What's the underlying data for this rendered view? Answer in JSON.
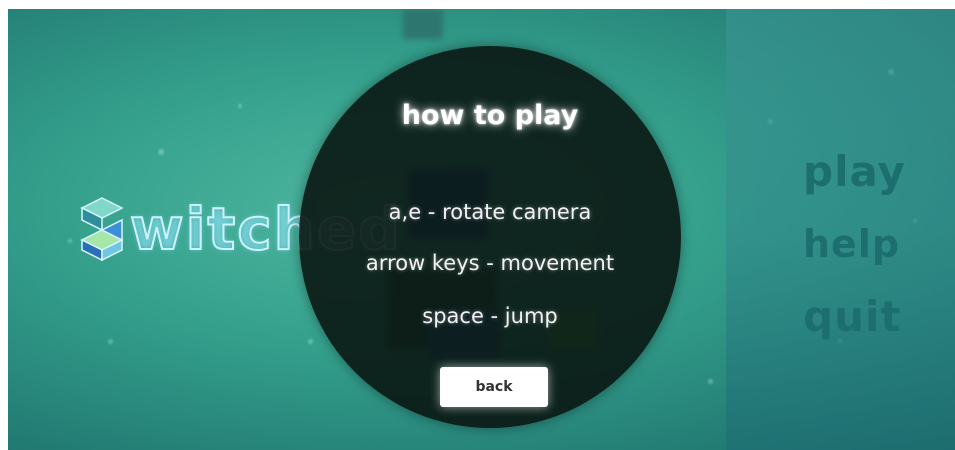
{
  "logo": {
    "text": "witched",
    "icon": "s-cube-logo-icon"
  },
  "help_panel": {
    "title": "how to play",
    "lines": [
      "a,e - rotate camera",
      "arrow keys - movement",
      "space - jump"
    ],
    "back_label": "back"
  },
  "menu": {
    "play_label": "play",
    "help_label": "help",
    "quit_label": "quit"
  },
  "colors": {
    "background": "#35a18d",
    "menu_text": "#1d6f6f",
    "overlay": "#0a1612",
    "logo_outline": "#cdf2ff"
  }
}
